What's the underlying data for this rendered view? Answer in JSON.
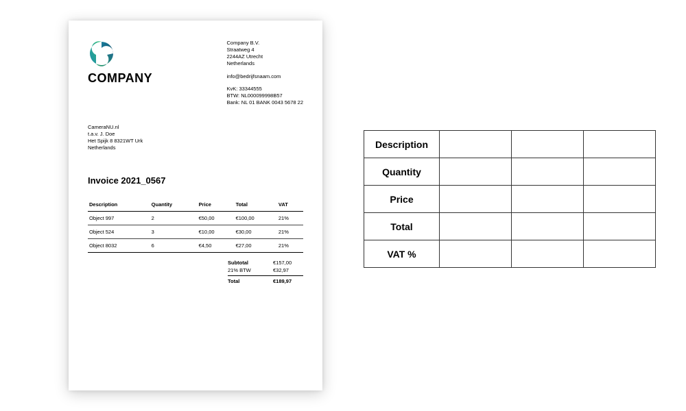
{
  "logo": {
    "wordmark": "COMPANY"
  },
  "company": {
    "name": "Company B.V.",
    "street": "Straatweg 4",
    "postal_city": "2244AZ Utrecht",
    "country": "Netherlands",
    "email": "info@bedrijfsnaam.com",
    "kvk_label": "KvK:",
    "kvk": "33344555",
    "btw_label": "BTW:",
    "btw": "NL000099998B57",
    "bank_label": "Bank:",
    "bank": "NL 01 BANK 0043 5678 22"
  },
  "client": {
    "name": "CameraNU.nl",
    "attn": "t.a.v. J. Doe",
    "street": "Het Spijk 8 8321WT Urk",
    "country": "Netherlands"
  },
  "invoice": {
    "title": "Invoice 2021_0567"
  },
  "items": {
    "headers": {
      "description": "Description",
      "quantity": "Quantity",
      "price": "Price",
      "total": "Total",
      "vat": "VAT"
    },
    "rows": [
      {
        "description": "Object 997",
        "quantity": "2",
        "price": "€50,00",
        "total": "€100,00",
        "vat": "21%"
      },
      {
        "description": "Object 524",
        "quantity": "3",
        "price": "€10,00",
        "total": "€30,00",
        "vat": "21%"
      },
      {
        "description": "Object 8032",
        "quantity": "6",
        "price": "€4,50",
        "total": "€27,00",
        "vat": "21%"
      }
    ]
  },
  "totals": {
    "subtotal_label": "Subtotal",
    "subtotal": "€157,00",
    "vat_label": "21% BTW",
    "vat": "€32,97",
    "grand_label": "Total",
    "grand": "€189,97"
  },
  "schema": {
    "rows": [
      "Description",
      "Quantity",
      "Price",
      "Total",
      "VAT %"
    ]
  }
}
